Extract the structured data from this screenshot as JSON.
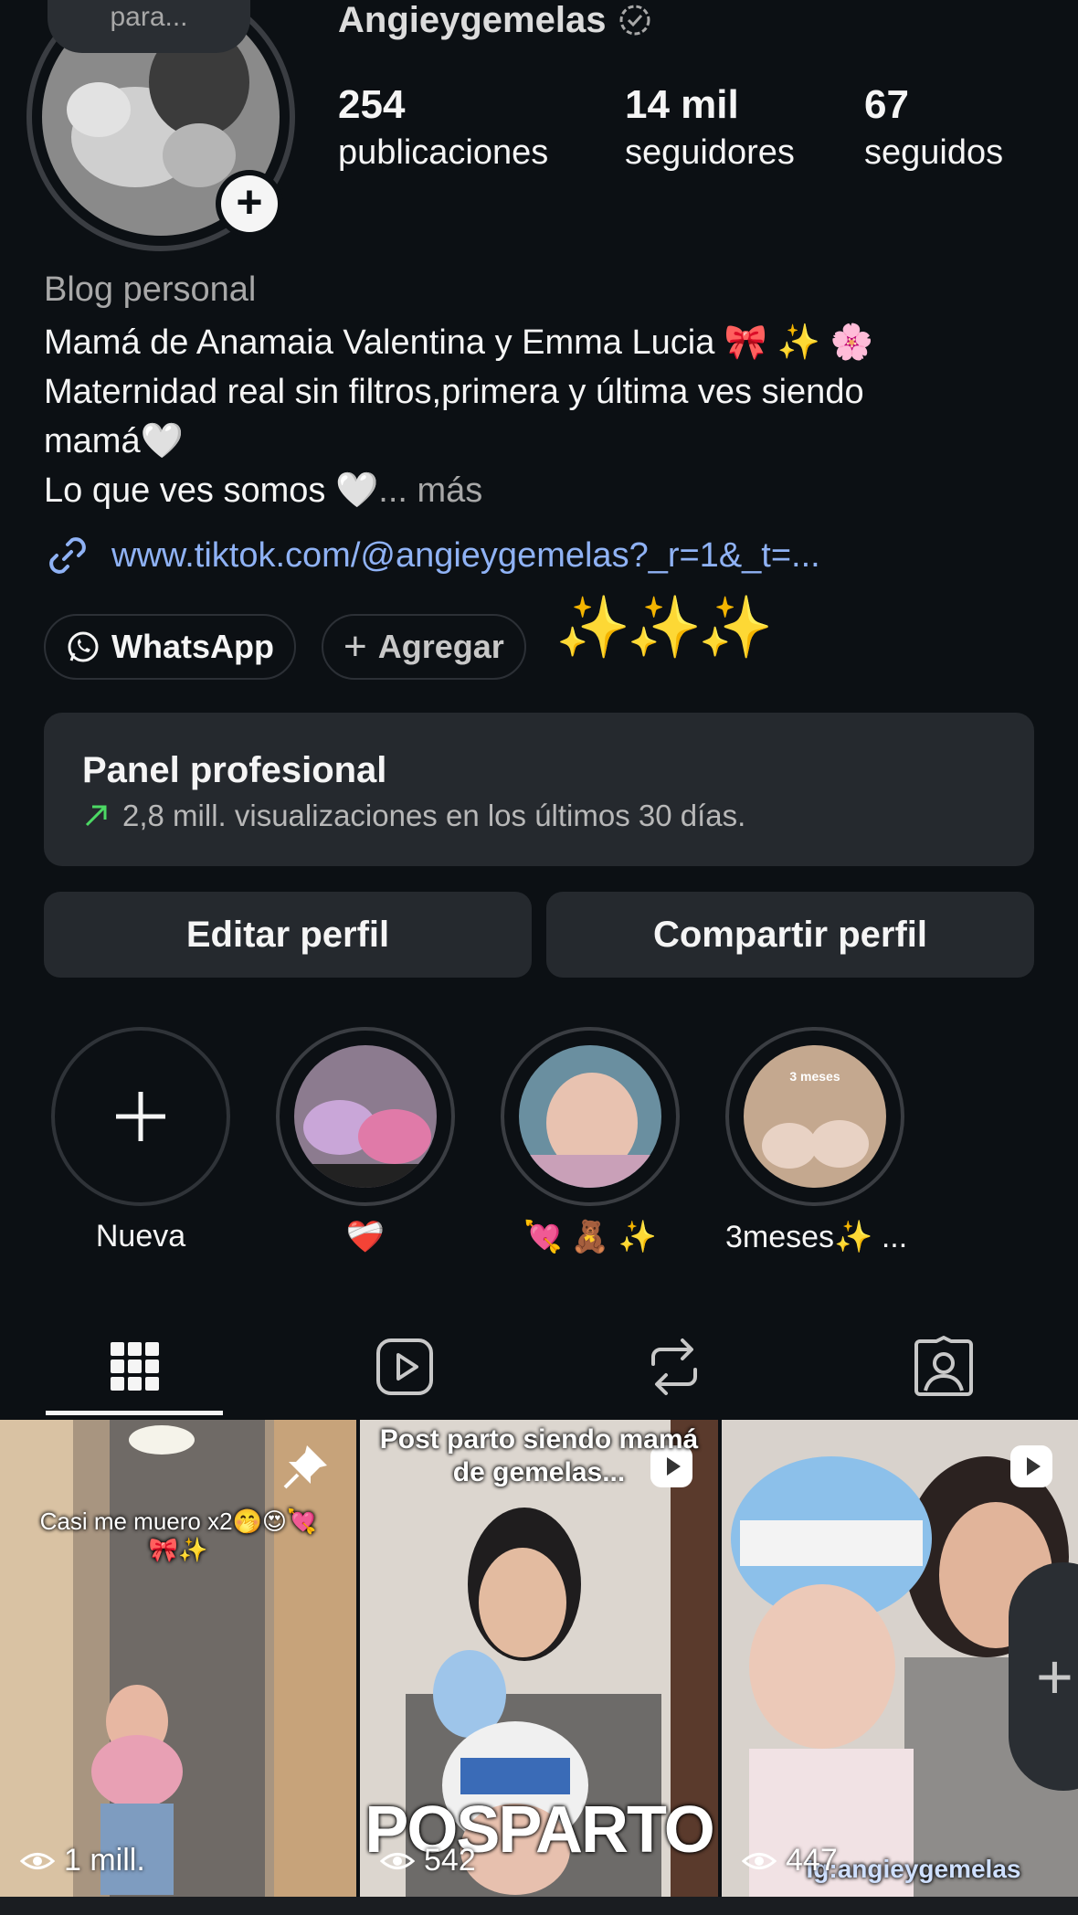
{
  "profile": {
    "note": "para...",
    "username": "Angieygemelas",
    "stats": [
      {
        "value": "254",
        "label": "publicaciones"
      },
      {
        "value": "14 mil",
        "label": "seguidores"
      },
      {
        "value": "67",
        "label": "seguidos"
      }
    ],
    "category": "Blog personal",
    "bio_lines": [
      "Mamá de Anamaia Valentina y Emma Lucia 🎀 ✨ 🌸",
      "Maternidad real sin filtros,primera y última ves siendo",
      "mamá🤍",
      "Lo que ves somos 🤍"
    ],
    "more_label": "... más",
    "link": "www.tiktok.com/@angieygemelas?_r=1&_t=...",
    "whatsapp_label": "WhatsApp",
    "add_label": "Agregar",
    "sparkles": "✨✨✨"
  },
  "panel": {
    "title": "Panel profesional",
    "subtitle": "2,8 mill. visualizaciones en los últimos 30 días."
  },
  "actions": {
    "edit": "Editar perfil",
    "share": "Compartir perfil"
  },
  "highlights": [
    {
      "label": "Nueva"
    },
    {
      "label": "❤️‍🩹"
    },
    {
      "label": "💘 🧸 ✨"
    },
    {
      "label": "3meses✨ ...",
      "caption": "3 meses"
    }
  ],
  "tabs": [
    "grid-icon",
    "reels-icon",
    "reposts-icon",
    "tagged-icon"
  ],
  "posts": [
    {
      "caption": "Casi me muero x2🤭😍💘\n🎀✨",
      "views": "1 mill."
    },
    {
      "caption": "Post parto siendo mamá\nde gemelas...",
      "big_text": "POSPARTO",
      "views": "542"
    },
    {
      "views": "447",
      "watermark": "Ig:angieygemelas"
    }
  ],
  "colors": {
    "background": "#0c1014",
    "panel": "#25292e",
    "link": "#8fb2f5",
    "trend": "#4cd964"
  }
}
